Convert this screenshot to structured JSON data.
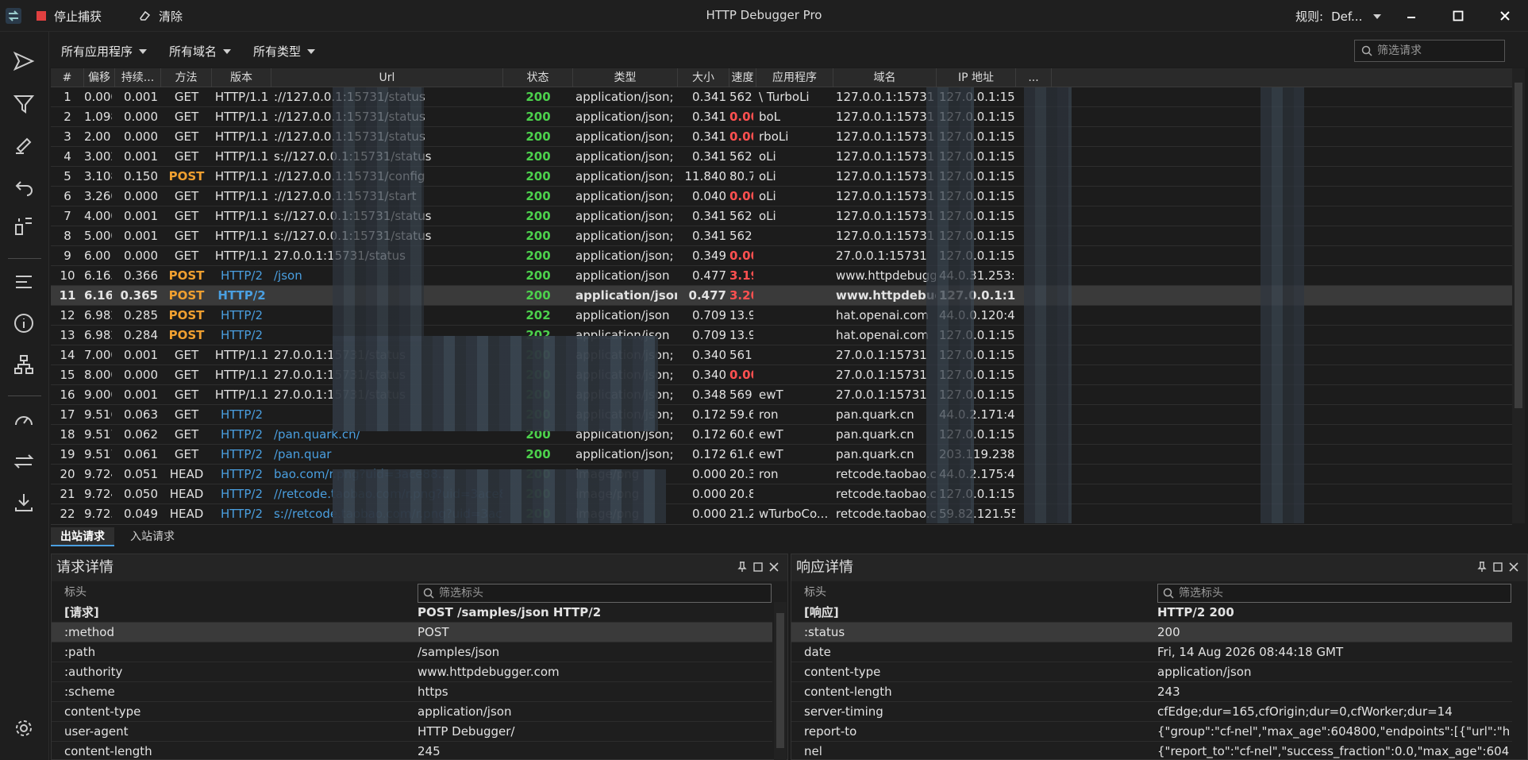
{
  "titlebar": {
    "title": "HTTP Debugger Pro",
    "stop_capture": "停止捕获",
    "clear": "清除",
    "rule_label": "规则:",
    "rule_value": "Def..."
  },
  "filters": {
    "apps": "所有应用程序",
    "domains": "所有域名",
    "types": "所有类型",
    "search_placeholder": "筛选请求"
  },
  "columns": [
    "#",
    "偏移",
    "持续...",
    "方法",
    "版本",
    "Url",
    "状态",
    "类型",
    "大小",
    "速度",
    "应用程序",
    "域名",
    "IP 地址",
    "..."
  ],
  "rows": [
    {
      "n": "1",
      "off": "0.000",
      "dur": "0.001",
      "m": "GET",
      "v": "HTTP/1.1",
      "url": "://127.0.0.1:15731/status",
      "st": "200",
      "type": "application/json; ch...",
      "size": "0.341",
      "spd": "562.5...",
      "app": "\\ TurboLi",
      "dom": "127.0.0.1:15731",
      "ip": "127.0.0.1:15731"
    },
    {
      "n": "2",
      "off": "1.098",
      "dur": "0.000",
      "m": "GET",
      "v": "HTTP/1.1",
      "url": "://127.0.0.1:15731/status",
      "st": "200",
      "type": "application/json; ch...",
      "size": "0.341",
      "spd": "0.000",
      "app": "boL",
      "dom": "127.0.0.1:15731",
      "ip": "127.0.0.1:15731"
    },
    {
      "n": "3",
      "off": "2.001",
      "dur": "0.000",
      "m": "GET",
      "v": "HTTP/1.1",
      "url": "://127.0.0.1:15731/status",
      "st": "200",
      "type": "application/json; ch...",
      "size": "0.341",
      "spd": "0.000",
      "app": "rboLi",
      "dom": "127.0.0.1:15731",
      "ip": "127.0.0.1:15731"
    },
    {
      "n": "4",
      "off": "3.002",
      "dur": "0.001",
      "m": "GET",
      "v": "HTTP/1.1",
      "url": "s://127.0.0.1:15731/status",
      "st": "200",
      "type": "application/json; ch...",
      "size": "0.341",
      "spd": "562.5...",
      "app": "oLi",
      "dom": "127.0.0.1:15731",
      "ip": "127.0.0.1:15731"
    },
    {
      "n": "5",
      "off": "3.108",
      "dur": "0.150",
      "m": "POST",
      "v": "HTTP/1.1",
      "url": "://127.0.0.1:15731/config",
      "st": "200",
      "type": "application/json; ch...",
      "size": "11.840",
      "spd": "80.768",
      "app": "oLi",
      "dom": "127.0.0.1:15731",
      "ip": "127.0.0.1:15731"
    },
    {
      "n": "6",
      "off": "3.260",
      "dur": "0.000",
      "m": "GET",
      "v": "HTTP/1.1",
      "url": "://127.0.0.1:15731/start",
      "st": "200",
      "type": "application/json; ch...",
      "size": "0.040",
      "spd": "0.000",
      "app": "oLi",
      "dom": "127.0.0.1:15731",
      "ip": "127.0.0.1:15731"
    },
    {
      "n": "7",
      "off": "4.000",
      "dur": "0.001",
      "m": "GET",
      "v": "HTTP/1.1",
      "url": "s://127.0.0.1:15731/status",
      "st": "200",
      "type": "application/json; ch...",
      "size": "0.341",
      "spd": "562.5...",
      "app": "oLi",
      "dom": "127.0.0.1:15731",
      "ip": "127.0.0.1:15731"
    },
    {
      "n": "8",
      "off": "5.000",
      "dur": "0.001",
      "m": "GET",
      "v": "HTTP/1.1",
      "url": "s://127.0.0.1:15731/status",
      "st": "200",
      "type": "application/json; ch...",
      "size": "0.341",
      "spd": "562.5...",
      "app": "",
      "dom": "127.0.0.1:15731",
      "ip": "127.0.0.1:15731"
    },
    {
      "n": "9",
      "off": "6.001",
      "dur": "0.000",
      "m": "GET",
      "v": "HTTP/1.1",
      "url": "27.0.0.1:15731/status",
      "st": "200",
      "type": "application/json; ch...",
      "size": "0.349",
      "spd": "0.000",
      "app": "",
      "dom": "27.0.0.1:15731",
      "ip": "127.0.0.1:15731"
    },
    {
      "n": "10",
      "off": "6.165",
      "dur": "0.366",
      "m": "POST",
      "v": "HTTP/2",
      "url": "/json",
      "st": "200",
      "type": "application/json",
      "size": "0.477",
      "spd": "3.199",
      "app": "",
      "dom": "www.httpdebugger...",
      "ip": "44.0.31.253:443"
    },
    {
      "n": "11",
      "off": "6.165",
      "dur": "0.365",
      "m": "POST",
      "v": "HTTP/2",
      "url": "",
      "st": "200",
      "type": "application/json",
      "size": "0.477",
      "spd": "3.208",
      "app": "",
      "dom": "www.httpdebugger...",
      "ip": "127.0.0.1:15732"
    },
    {
      "n": "12",
      "off": "6.982",
      "dur": "0.285",
      "m": "POST",
      "v": "HTTP/2",
      "url": "",
      "st": "202",
      "type": "application/json",
      "size": "0.709",
      "spd": "13.946",
      "app": "",
      "dom": "hat.openai.com",
      "ip": "44.0.0.120:443"
    },
    {
      "n": "13",
      "off": "6.982",
      "dur": "0.284",
      "m": "POST",
      "v": "HTTP/2",
      "url": "",
      "st": "202",
      "type": "application/json",
      "size": "0.709",
      "spd": "13.995",
      "app": "",
      "dom": "hat.openai.com",
      "ip": "127.0.0.1:15732"
    },
    {
      "n": "14",
      "off": "7.000",
      "dur": "0.001",
      "m": "GET",
      "v": "HTTP/1.1",
      "url": "27.0.0.1:15731/status",
      "st": "200",
      "type": "application/json; ch...",
      "size": "0.340",
      "spd": "561.5...",
      "app": "",
      "dom": "27.0.0.1:15731",
      "ip": "127.0.0.1:15731"
    },
    {
      "n": "15",
      "off": "8.000",
      "dur": "0.000",
      "m": "GET",
      "v": "HTTP/1.1",
      "url": "27.0.0.1:15731/status",
      "st": "200",
      "type": "application/json; ch...",
      "size": "0.340",
      "spd": "0.000",
      "app": "",
      "dom": "27.0.0.1:15731",
      "ip": "127.0.0.1:15731"
    },
    {
      "n": "16",
      "off": "9.000",
      "dur": "0.001",
      "m": "GET",
      "v": "HTTP/1.1",
      "url": "27.0.0.1:15731/status",
      "st": "200",
      "type": "application/json; ch...",
      "size": "0.348",
      "spd": "569.3...",
      "app": "ewT",
      "dom": "27.0.0.1:15731",
      "ip": "127.0.0.1:15731"
    },
    {
      "n": "17",
      "off": "9.516",
      "dur": "0.063",
      "m": "GET",
      "v": "HTTP/2",
      "url": "",
      "st": "200",
      "type": "application/json; ch...",
      "size": "0.172",
      "spd": "59.648",
      "app": "ron",
      "dom": "pan.quark.cn",
      "ip": "44.0.2.171:443"
    },
    {
      "n": "18",
      "off": "9.517",
      "dur": "0.062",
      "m": "GET",
      "v": "HTTP/2",
      "url": "/pan.quark.cn/",
      "st": "200",
      "type": "application/json; ch...",
      "size": "0.172",
      "spd": "60.610",
      "app": "ewT",
      "dom": "pan.quark.cn",
      "ip": "127.0.0.1:15732"
    },
    {
      "n": "19",
      "off": "9.517",
      "dur": "0.061",
      "m": "GET",
      "v": "HTTP/2",
      "url": "/pan.quar",
      "st": "200",
      "type": "application/json; ch...",
      "size": "0.172",
      "spd": "61.603",
      "app": "ewT",
      "dom": "pan.quark.cn",
      "ip": "203.119.238.4..."
    },
    {
      "n": "20",
      "off": "9.724",
      "dur": "0.051",
      "m": "HEAD",
      "v": "HTTP/2",
      "url": "bao.com/r.png?uid=3ace88...",
      "st": "200",
      "type": "image/png",
      "size": "0.000",
      "spd": "20.393",
      "app": "ron",
      "dom": "retcode.taobao.com",
      "ip": "44.0.2.175:443"
    },
    {
      "n": "21",
      "off": "9.724",
      "dur": "0.050",
      "m": "HEAD",
      "v": "HTTP/2",
      "url": "//retcode.taobao.com/r.png?uid=3ace88...",
      "st": "200",
      "type": "image/png",
      "size": "0.000",
      "spd": "20.801",
      "app": "",
      "dom": "retcode.taobao.com",
      "ip": "127.0.0.1:15732"
    },
    {
      "n": "22",
      "off": "9.725",
      "dur": "0.049",
      "m": "HEAD",
      "v": "HTTP/2",
      "url": "s://retcode.taobao.com/r.png?uid=3ace88...",
      "st": "200",
      "type": "image/png",
      "size": "0.000",
      "spd": "21.265",
      "app": "wTurboCo...",
      "dom": "retcode.taobao.com",
      "ip": "59.82.121.55:..."
    }
  ],
  "tabs": [
    "出站请求",
    "入站请求"
  ],
  "request_panel": {
    "title": "请求详情",
    "col_header": "标头",
    "filter_placeholder": "筛选标头",
    "rows": [
      {
        "k": "[请求]",
        "v": "POST /samples/json HTTP/2",
        "bold": true
      },
      {
        "k": ":method",
        "v": "POST"
      },
      {
        "k": ":path",
        "v": "/samples/json"
      },
      {
        "k": ":authority",
        "v": "www.httpdebugger.com"
      },
      {
        "k": ":scheme",
        "v": "https"
      },
      {
        "k": "content-type",
        "v": "application/json"
      },
      {
        "k": "user-agent",
        "v": "HTTP Debugger/"
      },
      {
        "k": "content-length",
        "v": "245"
      }
    ]
  },
  "response_panel": {
    "title": "响应详情",
    "col_header": "标头",
    "filter_placeholder": "筛选标头",
    "rows": [
      {
        "k": "[响应]",
        "v": "HTTP/2 200",
        "bold": true
      },
      {
        "k": ":status",
        "v": "200"
      },
      {
        "k": "date",
        "v": "Fri, 14 Aug 2026 08:44:18 GMT"
      },
      {
        "k": "content-type",
        "v": "application/json"
      },
      {
        "k": "content-length",
        "v": "243"
      },
      {
        "k": "server-timing",
        "v": "cfEdge;dur=165,cfOrigin;dur=0,cfWorker;dur=14"
      },
      {
        "k": "report-to",
        "v": "{\"group\":\"cf-nel\",\"max_age\":604800,\"endpoints\":[{\"url\":\"ht..."
      },
      {
        "k": "nel",
        "v": "{\"report_to\":\"cf-nel\",\"success_fraction\":0.0,\"max_age\":604..."
      }
    ]
  },
  "colors": {
    "post": "#f0a030",
    "http2": "#4a9fe0",
    "status_ok": "#4cd14c",
    "speed_zero": "#ff5050",
    "stop": "#e04040"
  }
}
